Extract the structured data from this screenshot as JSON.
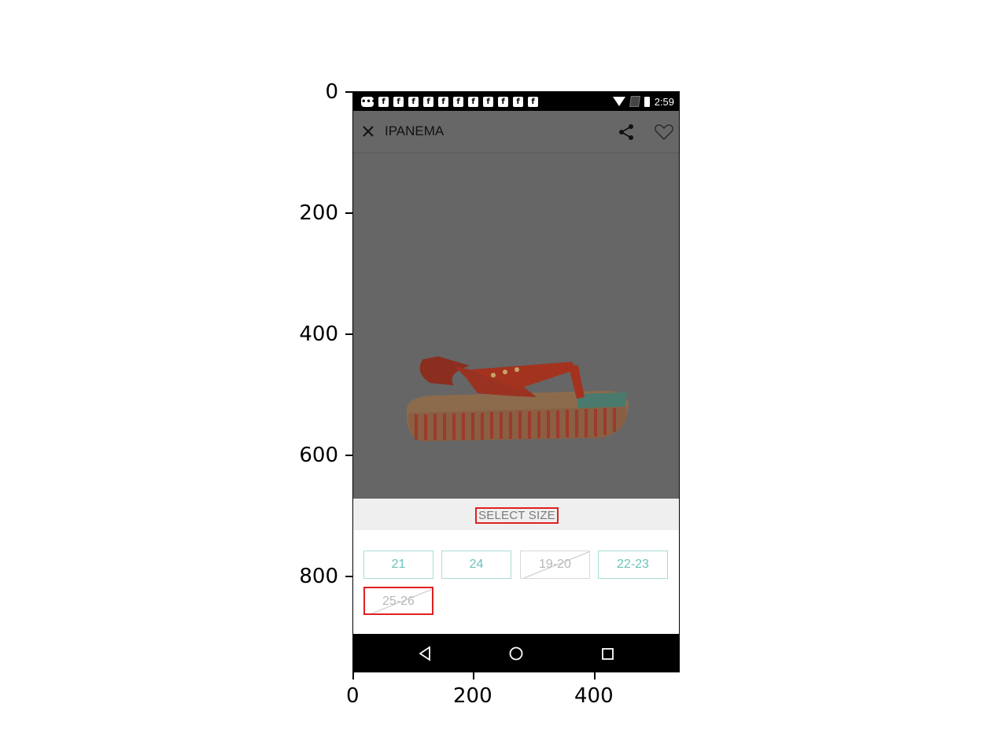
{
  "axes": {
    "y_ticks": [
      "0",
      "200",
      "400",
      "600",
      "800"
    ],
    "x_ticks": [
      "0",
      "200",
      "400"
    ]
  },
  "status_bar": {
    "notification_icons": [
      "message-icon",
      "facebook-icon",
      "facebook-icon",
      "facebook-icon",
      "facebook-icon",
      "facebook-icon",
      "facebook-icon",
      "facebook-icon",
      "facebook-icon",
      "facebook-icon",
      "facebook-icon",
      "facebook-icon"
    ],
    "time": "2:59"
  },
  "toolbar": {
    "title": "IPANEMA",
    "close_icon": "close-icon",
    "share_icon": "share-icon",
    "wishlist_icon": "heart-icon"
  },
  "size_selector": {
    "header": "SELECT SIZE",
    "sizes": [
      {
        "label": "21",
        "available": true
      },
      {
        "label": "24",
        "available": true
      },
      {
        "label": "19-20",
        "available": false
      },
      {
        "label": "22-23",
        "available": true
      },
      {
        "label": "25-26",
        "available": false
      }
    ]
  },
  "colors": {
    "accent": "#6cc3bc",
    "overlay": "#666666",
    "highlight_box": "#e02020"
  }
}
